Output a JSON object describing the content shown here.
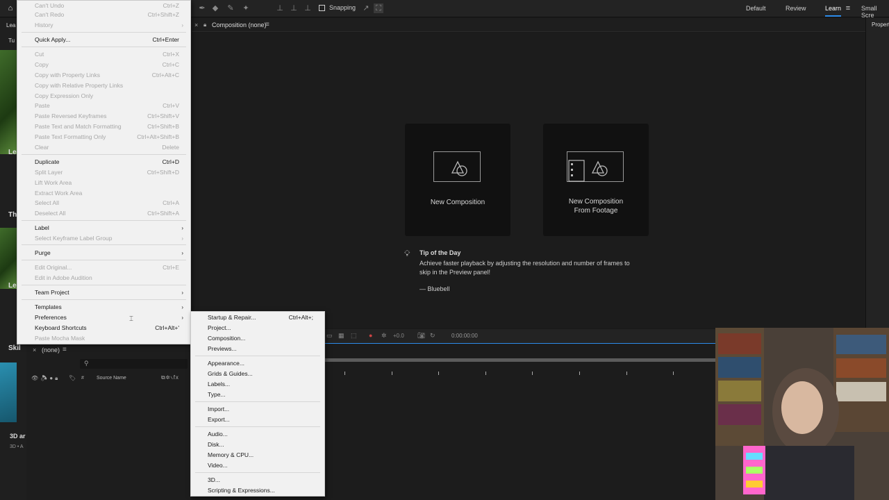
{
  "toolbar": {
    "snapping_label": "Snapping",
    "workspaces": [
      "Default",
      "Review",
      "Learn",
      "Small Scre"
    ],
    "active_workspace": "Learn"
  },
  "left_panel": {
    "tab_fragment": "Lea",
    "tab2_fragment": "Tu",
    "label_le": "Le",
    "label_th": "Th",
    "label_le2": "Le",
    "label_skill": "Skil",
    "label_3d": "3D ar",
    "label_3d_sub": "3D • A"
  },
  "composition": {
    "tab_label": "Composition (none)",
    "properties_label": "Propert",
    "cards": [
      {
        "label_line1": "New Composition",
        "label_line2": ""
      },
      {
        "label_line1": "New Composition",
        "label_line2": "From Footage"
      }
    ],
    "tip": {
      "title": "Tip of the Day",
      "body": "Achieve faster playback by adjusting the resolution and number of frames to skip in the Preview panel!",
      "author": "— Bluebell"
    }
  },
  "timeline": {
    "timecode": "0:00:00:00",
    "exposure": "+0.0"
  },
  "project": {
    "comp_label": "(none)",
    "source_name_header": "Source Name"
  },
  "edit_menu": {
    "items": [
      {
        "label": "Can't Undo",
        "shortcut": "Ctrl+Z",
        "disabled": true
      },
      {
        "label": "Can't Redo",
        "shortcut": "Ctrl+Shift+Z",
        "disabled": true
      },
      {
        "label": "History",
        "shortcut": "",
        "disabled": true,
        "submenu": true
      },
      {
        "label": "Quick Apply...",
        "shortcut": "Ctrl+Enter",
        "disabled": false
      },
      {
        "label": "Cut",
        "shortcut": "Ctrl+X",
        "disabled": true
      },
      {
        "label": "Copy",
        "shortcut": "Ctrl+C",
        "disabled": true
      },
      {
        "label": "Copy with Property Links",
        "shortcut": "Ctrl+Alt+C",
        "disabled": true
      },
      {
        "label": "Copy with Relative Property Links",
        "shortcut": "",
        "disabled": true
      },
      {
        "label": "Copy Expression Only",
        "shortcut": "",
        "disabled": true
      },
      {
        "label": "Paste",
        "shortcut": "Ctrl+V",
        "disabled": true
      },
      {
        "label": "Paste Reversed Keyframes",
        "shortcut": "Ctrl+Shift+V",
        "disabled": true
      },
      {
        "label": "Paste Text and Match Formatting",
        "shortcut": "Ctrl+Shift+B",
        "disabled": true
      },
      {
        "label": "Paste Text Formatting Only",
        "shortcut": "Ctrl+Alt+Shift+B",
        "disabled": true
      },
      {
        "label": "Clear",
        "shortcut": "Delete",
        "disabled": true
      },
      {
        "label": "Duplicate",
        "shortcut": "Ctrl+D",
        "disabled": false
      },
      {
        "label": "Split Layer",
        "shortcut": "Ctrl+Shift+D",
        "disabled": true
      },
      {
        "label": "Lift Work Area",
        "shortcut": "",
        "disabled": true
      },
      {
        "label": "Extract Work Area",
        "shortcut": "",
        "disabled": true
      },
      {
        "label": "Select All",
        "shortcut": "Ctrl+A",
        "disabled": true
      },
      {
        "label": "Deselect All",
        "shortcut": "Ctrl+Shift+A",
        "disabled": true
      },
      {
        "label": "Label",
        "shortcut": "",
        "disabled": false,
        "submenu": true
      },
      {
        "label": "Select Keyframe Label Group",
        "shortcut": "",
        "disabled": true,
        "submenu": true
      },
      {
        "label": "Purge",
        "shortcut": "",
        "disabled": false,
        "submenu": true
      },
      {
        "label": "Edit Original...",
        "shortcut": "Ctrl+E",
        "disabled": true
      },
      {
        "label": "Edit in Adobe Audition",
        "shortcut": "",
        "disabled": true
      },
      {
        "label": "Team Project",
        "shortcut": "",
        "disabled": false,
        "submenu": true
      },
      {
        "label": "Templates",
        "shortcut": "",
        "disabled": false,
        "submenu": true
      },
      {
        "label": "Preferences",
        "shortcut": "",
        "disabled": false,
        "submenu": true
      },
      {
        "label": "Keyboard Shortcuts",
        "shortcut": "Ctrl+Alt+'",
        "disabled": false
      },
      {
        "label": "Paste Mocha Mask",
        "shortcut": "",
        "disabled": true
      }
    ]
  },
  "preferences_menu": {
    "items": [
      {
        "label": "Startup & Repair...",
        "shortcut": "Ctrl+Alt+;"
      },
      {
        "label": "Project...",
        "shortcut": ""
      },
      {
        "label": "Composition...",
        "shortcut": ""
      },
      {
        "label": "Previews...",
        "shortcut": ""
      },
      {
        "label": "Appearance...",
        "shortcut": ""
      },
      {
        "label": "Grids & Guides...",
        "shortcut": ""
      },
      {
        "label": "Labels...",
        "shortcut": ""
      },
      {
        "label": "Type...",
        "shortcut": ""
      },
      {
        "label": "Import...",
        "shortcut": ""
      },
      {
        "label": "Export...",
        "shortcut": ""
      },
      {
        "label": "Audio...",
        "shortcut": ""
      },
      {
        "label": "Disk...",
        "shortcut": ""
      },
      {
        "label": "Memory & CPU...",
        "shortcut": ""
      },
      {
        "label": "Video...",
        "shortcut": ""
      },
      {
        "label": "3D...",
        "shortcut": ""
      },
      {
        "label": "Scripting & Expressions...",
        "shortcut": ""
      }
    ]
  },
  "colors": {
    "accent": "#2d8ceb",
    "menu_bg": "#f1f1f1",
    "menu_disabled": "#a6a6a6"
  }
}
